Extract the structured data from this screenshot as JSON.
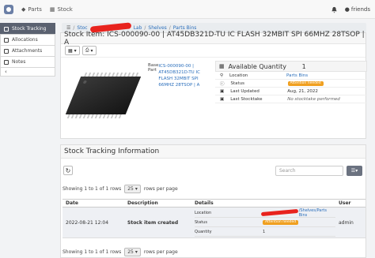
{
  "navbar": {
    "links": [
      {
        "label": "Parts",
        "icon": "shapes-icon"
      },
      {
        "label": "Stock",
        "icon": "boxes-icon"
      }
    ],
    "user": "friends",
    "colors": {
      "logo": "#6b7fa6"
    }
  },
  "sidebar": {
    "items": [
      {
        "label": "Stock Tracking"
      },
      {
        "label": "Allocations"
      },
      {
        "label": "Attachments"
      },
      {
        "label": "Notes"
      }
    ],
    "collapse": "‹"
  },
  "breadcrumb": {
    "items": [
      "Stoc",
      "Lab",
      "Shelves",
      "Parts Bins"
    ]
  },
  "stock_item": {
    "title": "Stock Item: ICS-000090-00 | AT45DB321D-TU IC FLASH 32MBIT SPI 66MHZ 28TSOP | A",
    "base_part_label": "Base Part",
    "base_part_value": "ICS-000090-00 | AT45DB321D-TU IC FLASH 32MBIT SPI 66MHZ 28TSOP | A",
    "available_quantity_label": "Available Quantity",
    "available_quantity": "1",
    "location_label": "Location",
    "location_value": "Parts Bins",
    "status_label": "Status",
    "status_value": "Attention needed",
    "last_updated_label": "Last Updated",
    "last_updated": "Aug, 21, 2022",
    "last_stocktake_label": "Last Stocktake",
    "last_stocktake": "No stocktake performed",
    "colors": {
      "status_badge": "#f0a020"
    }
  },
  "tracking": {
    "title": "Stock Tracking Information",
    "search_placeholder": "Search",
    "showing": "Showing 1 to 1 of 1 rows",
    "page_size": "25",
    "rows_per_page": "rows per page",
    "columns": [
      "Date",
      "Description",
      "Details",
      "User"
    ],
    "rows": [
      {
        "date": "2022-08-21 12:04",
        "description": "Stock item created",
        "details": [
          {
            "key": "Location",
            "value": "/Shelves/Parts Bins"
          },
          {
            "key": "Status",
            "value": "Attention needed"
          },
          {
            "key": "Quantity",
            "value": "1"
          }
        ],
        "user": "admin"
      }
    ]
  }
}
